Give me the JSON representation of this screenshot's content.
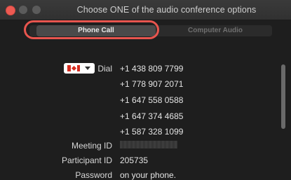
{
  "window": {
    "title": "Choose ONE of the audio conference options"
  },
  "tabs": [
    {
      "label": "Phone Call",
      "selected": true
    },
    {
      "label": "Computer Audio",
      "selected": false
    }
  ],
  "dial": {
    "label": "Dial",
    "country": "Canada",
    "numbers": [
      "+1 438 809 7799",
      "+1 778 907 2071",
      "+1 647 558 0588",
      "+1 647 374 4685",
      "+1 587 328 1099"
    ]
  },
  "meeting": {
    "meeting_id_label": "Meeting ID",
    "participant_id_label": "Participant ID",
    "participant_id": "205735",
    "password_label": "Password",
    "password_value": "on your phone."
  },
  "colors": {
    "window_bg": "#1e1e1e",
    "highlight": "#e8554e",
    "close_button": "#ee5a52"
  },
  "icons": {
    "flag": "canada-flag-icon",
    "dropdown": "chevron-down-icon"
  }
}
